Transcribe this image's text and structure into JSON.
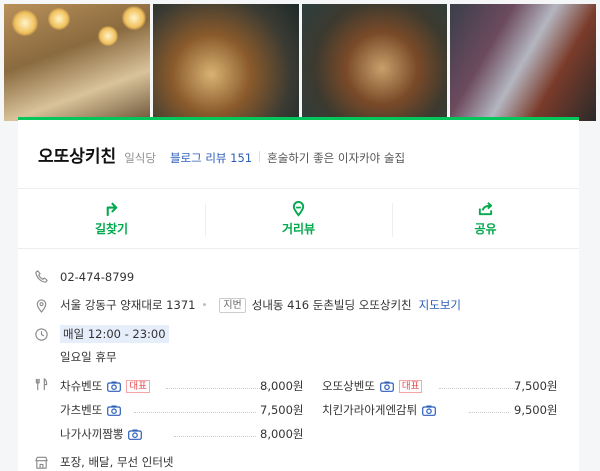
{
  "place": {
    "name": "오또상키친",
    "category": "일식당",
    "review_label": "블로그 리뷰 151",
    "description": "혼술하기 좋은 이자카야 술집"
  },
  "actions": [
    {
      "label": "길찾기",
      "icon": "directions-icon"
    },
    {
      "label": "거리뷰",
      "icon": "street-view-icon"
    },
    {
      "label": "공유",
      "icon": "share-icon"
    }
  ],
  "info": {
    "phone": "02-474-8799",
    "address": "서울 강동구 양재대로 1371",
    "jibun_badge": "지번",
    "jibun_address": "성내동 416 둔촌빌딩 오또상키친",
    "map_link": "지도보기",
    "hours": "매일 12:00 - 23:00",
    "holiday": "일요일 휴무",
    "facilities": "포장, 배달, 무선 인터넷"
  },
  "menu_badge": "대표",
  "menu": [
    {
      "name": "차슈벤또",
      "price": "8,000원",
      "rep": true
    },
    {
      "name": "오또상벤또",
      "price": "7,500원",
      "rep": true
    },
    {
      "name": "가츠벤또",
      "price": "7,500원",
      "rep": false
    },
    {
      "name": "치킨가라아게엔감튀",
      "price": "9,500원",
      "rep": false
    },
    {
      "name": "나가사끼짬뽕",
      "price": "8,000원",
      "rep": false
    }
  ],
  "colors": {
    "accent": "#03c75a",
    "link": "#2b5db8",
    "badge": "#e5484d"
  }
}
